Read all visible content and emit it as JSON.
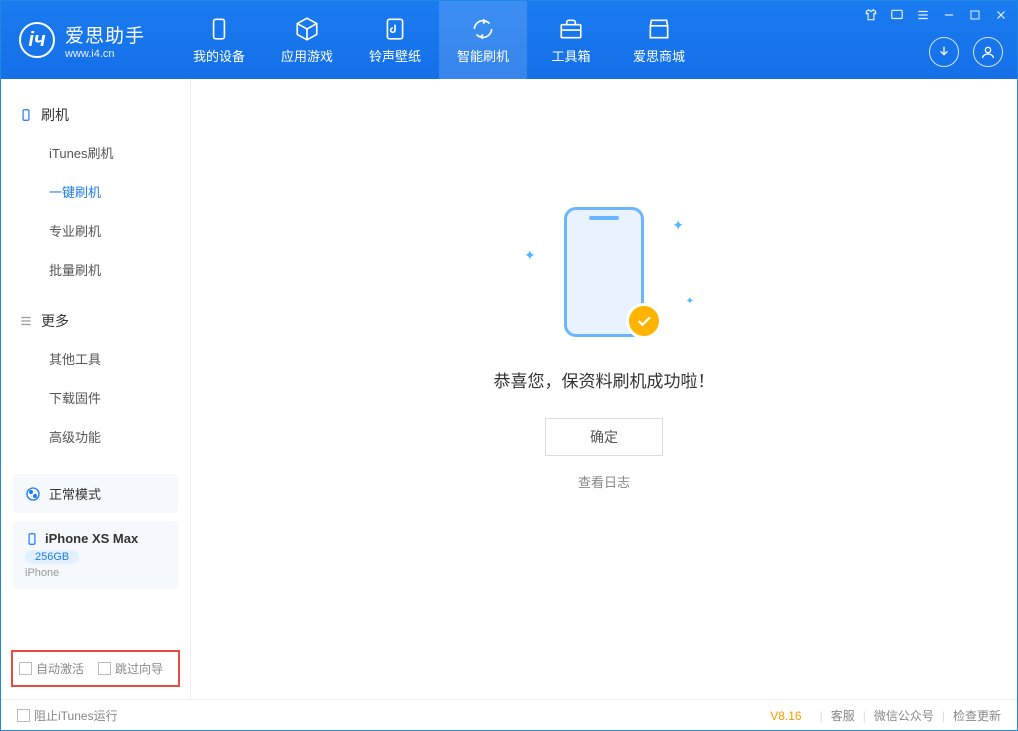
{
  "app": {
    "title": "爱思助手",
    "subtitle": "www.i4.cn"
  },
  "nav": [
    {
      "label": "我的设备"
    },
    {
      "label": "应用游戏"
    },
    {
      "label": "铃声壁纸"
    },
    {
      "label": "智能刷机"
    },
    {
      "label": "工具箱"
    },
    {
      "label": "爱思商城"
    }
  ],
  "sidebar": {
    "group1": {
      "title": "刷机",
      "items": [
        "iTunes刷机",
        "一键刷机",
        "专业刷机",
        "批量刷机"
      ]
    },
    "group2": {
      "title": "更多",
      "items": [
        "其他工具",
        "下载固件",
        "高级功能"
      ]
    }
  },
  "mode": {
    "label": "正常模式"
  },
  "device": {
    "name": "iPhone XS Max",
    "storage": "256GB",
    "type": "iPhone"
  },
  "options": {
    "auto_activate": "自动激活",
    "skip_guide": "跳过向导"
  },
  "main": {
    "message": "恭喜您，保资料刷机成功啦！",
    "ok": "确定",
    "log": "查看日志"
  },
  "footer": {
    "block_itunes": "阻止iTunes运行",
    "version": "V8.16",
    "support": "客服",
    "wechat": "微信公众号",
    "update": "检查更新"
  }
}
